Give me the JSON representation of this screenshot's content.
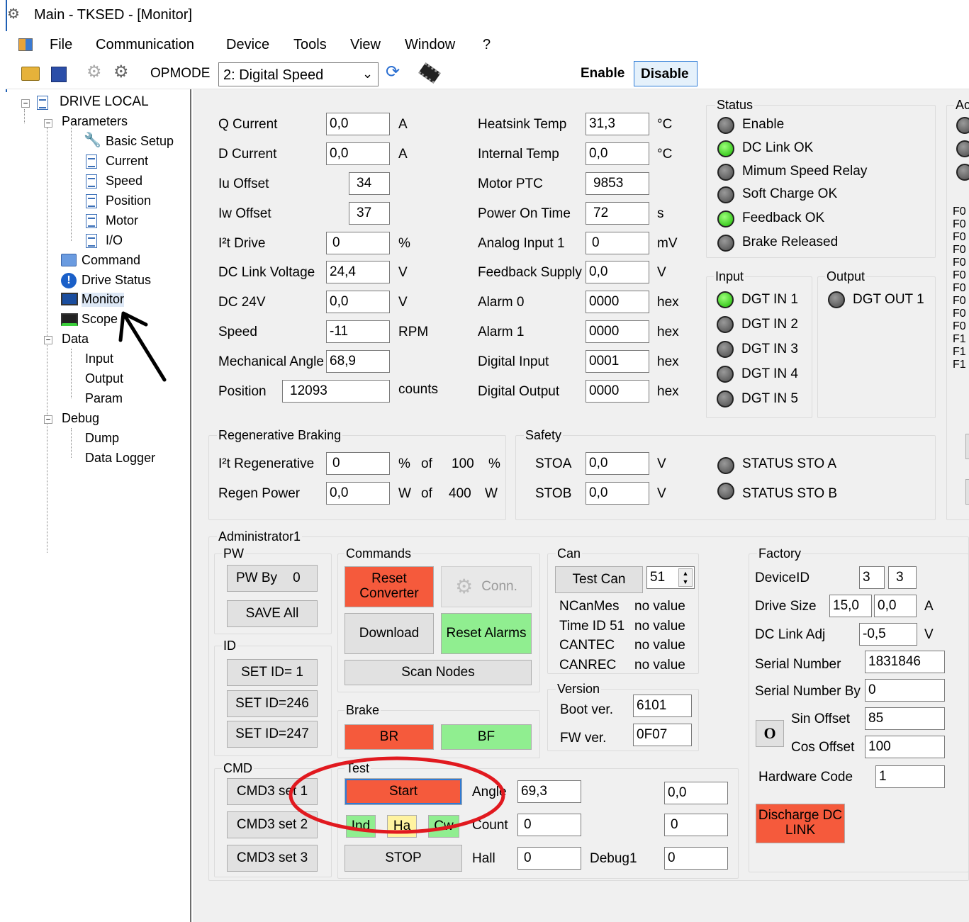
{
  "window": {
    "title": "Main - TKSED - [Monitor]"
  },
  "menu": [
    "File",
    "Communication",
    "Device",
    "Tools",
    "View",
    "Window",
    "?"
  ],
  "toolbar": {
    "opmode_label": "OPMODE",
    "opmode_value": "2: Digital Speed",
    "enable": "Enable",
    "disable": "Disable"
  },
  "tree": {
    "root": "DRIVE LOCAL",
    "parameters": "Parameters",
    "basic_setup": "Basic Setup",
    "current": "Current",
    "speed": "Speed",
    "position": "Position",
    "motor": "Motor",
    "io": "I/O",
    "command": "Command",
    "drive_status": "Drive Status",
    "monitor": "Monitor",
    "scope": "Scope",
    "data": "Data",
    "input": "Input",
    "output": "Output",
    "param": "Param",
    "debug": "Debug",
    "dump": "Dump",
    "data_logger": "Data Logger"
  },
  "values_left": [
    {
      "label": "Q Current",
      "value": "0,0",
      "unit": "A"
    },
    {
      "label": "D Current",
      "value": "0,0",
      "unit": "A"
    },
    {
      "label": "Iu Offset",
      "value": "34",
      "unit": ""
    },
    {
      "label": "Iw Offset",
      "value": "37",
      "unit": ""
    },
    {
      "label": "I²t Drive",
      "value": "0",
      "unit": "%"
    },
    {
      "label": "DC Link Voltage",
      "value": "24,4",
      "unit": "V"
    },
    {
      "label": "DC 24V",
      "value": "0,0",
      "unit": "V"
    },
    {
      "label": "Speed",
      "value": "-11",
      "unit": "RPM"
    },
    {
      "label": "Mechanical Angle",
      "value": "68,9",
      "unit": ""
    },
    {
      "label": "Position",
      "value": "12093",
      "unit": "counts"
    }
  ],
  "values_mid": [
    {
      "label": "Heatsink Temp",
      "value": "31,3",
      "unit": "°C"
    },
    {
      "label": "Internal Temp",
      "value": "0,0",
      "unit": "°C"
    },
    {
      "label": "Motor PTC",
      "value": "9853",
      "unit": ""
    },
    {
      "label": "Power On Time",
      "value": "72",
      "unit": "s"
    },
    {
      "label": "Analog Input 1",
      "value": "0",
      "unit": "mV"
    },
    {
      "label": "Feedback Supply",
      "value": "0,0",
      "unit": "V"
    },
    {
      "label": "Alarm 0",
      "value": "0000",
      "unit": "hex"
    },
    {
      "label": "Alarm 1",
      "value": "0000",
      "unit": "hex"
    },
    {
      "label": "Digital Input",
      "value": "0001",
      "unit": "hex"
    },
    {
      "label": "Digital Output",
      "value": "0000",
      "unit": "hex"
    }
  ],
  "status": {
    "title": "Status",
    "items": [
      {
        "label": "Enable",
        "on": false
      },
      {
        "label": "DC Link OK",
        "on": true
      },
      {
        "label": "Mimum Speed Relay",
        "on": false
      },
      {
        "label": "Soft Charge OK",
        "on": false
      },
      {
        "label": "Feedback OK",
        "on": true
      },
      {
        "label": "Brake Released",
        "on": false
      }
    ]
  },
  "input": {
    "title": "Input",
    "items": [
      {
        "label": "DGT IN 1",
        "on": true
      },
      {
        "label": "DGT IN 2",
        "on": false
      },
      {
        "label": "DGT IN 3",
        "on": false
      },
      {
        "label": "DGT IN 4",
        "on": false
      },
      {
        "label": "DGT IN 5",
        "on": false
      }
    ]
  },
  "output": {
    "title": "Output",
    "items": [
      {
        "label": "DGT OUT 1",
        "on": false
      }
    ]
  },
  "right_panel": {
    "title": "Ac",
    "faults": [
      "F0",
      "F0",
      "F0",
      "F0",
      "F0",
      "F0",
      "F0",
      "F0",
      "F0",
      "F0",
      "F1",
      "F1",
      "F1"
    ]
  },
  "regen": {
    "title": "Regenerative Braking",
    "i2t_label": "I²t Regenerative",
    "i2t_value": "0",
    "i2t_unit": "%",
    "of": "of",
    "i2t_max": "100",
    "i2t_max_unit": "%",
    "power_label": "Regen Power",
    "power_value": "0,0",
    "power_unit": "W",
    "power_max": "400",
    "power_max_unit": "W"
  },
  "safety": {
    "title": "Safety",
    "stoa_label": "STOA",
    "stoa_value": "0,0",
    "stoa_unit": "V",
    "stob_label": "STOB",
    "stob_value": "0,0",
    "stob_unit": "V",
    "status_a": "STATUS STO A",
    "status_b": "STATUS STO B"
  },
  "admin": {
    "title": "Administrator1"
  },
  "pw": {
    "title": "PW",
    "pw_by": "PW By",
    "pw_value": "0",
    "save_all": "SAVE All"
  },
  "id": {
    "title": "ID",
    "set1": "SET ID= 1",
    "set246": "SET ID=246",
    "set247": "SET ID=247"
  },
  "cmd": {
    "title": "CMD",
    "cmd1": "CMD3 set 1",
    "cmd2": "CMD3 set 2",
    "cmd3": "CMD3 set 3"
  },
  "commands": {
    "title": "Commands",
    "reset_converter": "Reset Converter",
    "conn": "Conn.",
    "download": "Download",
    "reset_alarms": "Reset Alarms",
    "scan_nodes": "Scan Nodes"
  },
  "brake": {
    "title": "Brake",
    "br": "BR",
    "bf": "BF"
  },
  "test": {
    "title": "Test",
    "start": "Start",
    "ind": "Ind",
    "ha": "Ha",
    "cw": "Cw",
    "stop": "STOP",
    "angle_label": "Angle",
    "angle_value": "69,3",
    "count_label": "Count",
    "count_value": "0",
    "hall_label": "Hall",
    "hall_value": "0",
    "debug_label": "Debug1",
    "debug_value": "0",
    "r1": "0,0",
    "r2": "0"
  },
  "can": {
    "title": "Can",
    "test_can": "Test Can",
    "can_id": "51",
    "rows": [
      {
        "label": "NCanMes",
        "value": "no value"
      },
      {
        "label": "Time ID 51",
        "value": "no value"
      },
      {
        "label": "CANTEC",
        "value": "no value"
      },
      {
        "label": "CANREC",
        "value": "no value"
      }
    ]
  },
  "version": {
    "title": "Version",
    "boot_label": "Boot ver.",
    "boot_value": "6101",
    "fw_label": "FW ver.",
    "fw_value": "0F07"
  },
  "factory": {
    "title": "Factory",
    "device_id_label": "DeviceID",
    "device_id_1": "3",
    "device_id_2": "3",
    "drive_size_label": "Drive Size",
    "drive_size_1": "15,0",
    "drive_size_2": "0,0",
    "drive_size_unit": "A",
    "dc_adj_label": "DC Link Adj",
    "dc_adj_value": "-0,5",
    "dc_adj_unit": "V",
    "serial_label": "Serial Number",
    "serial_value": "1831846",
    "serial_by_label": "Serial Number By",
    "serial_by_value": "0",
    "o_button": "O",
    "sin_label": "Sin Offset",
    "sin_value": "85",
    "cos_label": "Cos Offset",
    "cos_value": "100",
    "hw_label": "Hardware Code",
    "hw_value": "1",
    "discharge": "Discharge DC LINK"
  }
}
